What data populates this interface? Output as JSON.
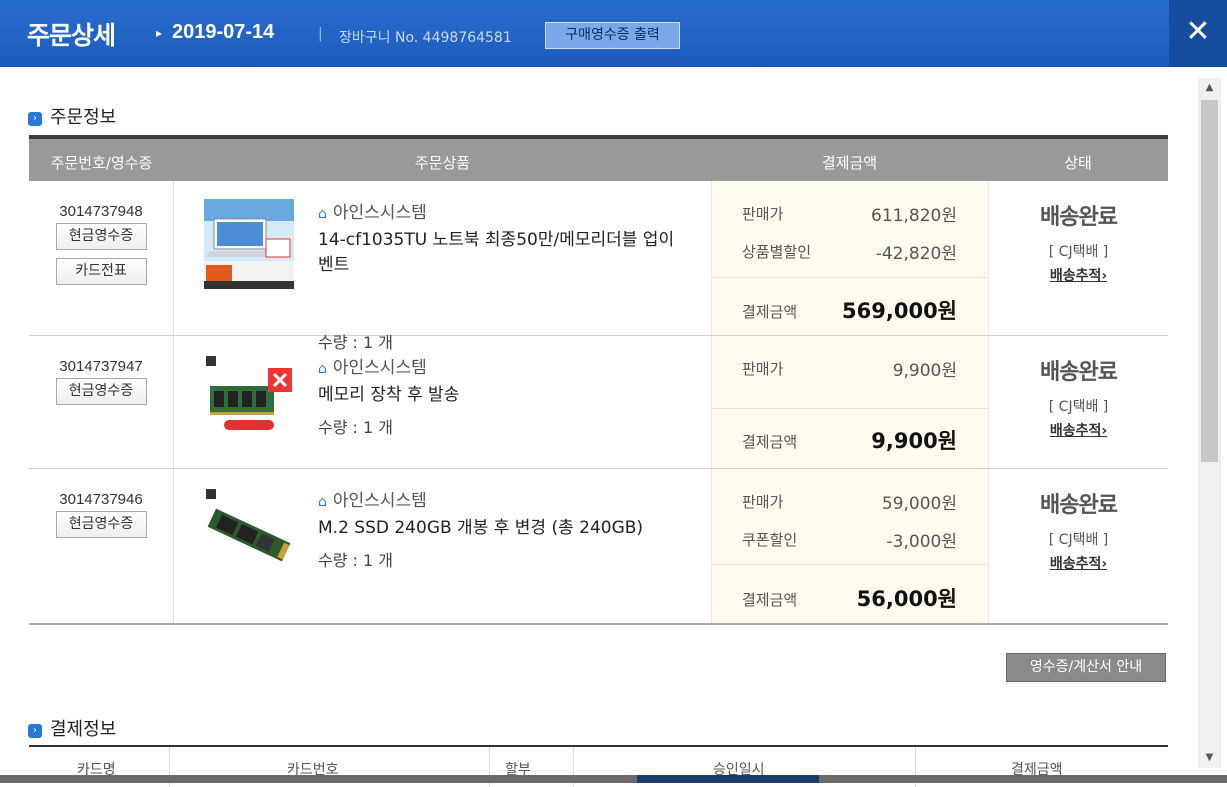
{
  "header": {
    "title": "주문상세",
    "date": "2019-07-14",
    "separator": "|",
    "cart_label": "장바구니 No. 4498764581",
    "receipt_print_label": "구매영수증 출력",
    "close_glyph": "✕"
  },
  "order_section": {
    "title": "주문정보",
    "columns": [
      "주문번호/영수증",
      "주문상품",
      "결제금액",
      "상태"
    ],
    "rows": [
      {
        "order_no": "3014737948",
        "buttons": [
          "현금영수증",
          "카드전표"
        ],
        "seller": "아인스시스템",
        "product": "14-cf1035TU 노트북 최종50만/메모리더블 업이벤트",
        "qty": "수량 : 1 개",
        "price_label": "판매가",
        "price": "611,820원",
        "discount_label": "상품별할인",
        "discount": "-42,820원",
        "total_label": "결제금액",
        "total": "569,000원",
        "status": "배송완료",
        "courier": "[ CJ택배 ]",
        "track_label": "배송추적"
      },
      {
        "order_no": "3014737947",
        "buttons": [
          "현금영수증"
        ],
        "seller": "아인스시스템",
        "product": "메모리 장착 후 발송",
        "qty": "수량 : 1 개",
        "price_label": "판매가",
        "price": "9,900원",
        "total_label": "결제금액",
        "total": "9,900원",
        "status": "배송완료",
        "courier": "[ CJ택배 ]",
        "track_label": "배송추적"
      },
      {
        "order_no": "3014737946",
        "buttons": [
          "현금영수증"
        ],
        "seller": "아인스시스템",
        "product": "M.2 SSD 240GB 개봉 후 변경 (총 240GB)",
        "qty": "수량 : 1 개",
        "price_label": "판매가",
        "price": "59,000원",
        "discount_label": "쿠폰할인",
        "discount": "-3,000원",
        "total_label": "결제금액",
        "total": "56,000원",
        "status": "배송완료",
        "courier": "[ CJ택배 ]",
        "track_label": "배송추적"
      }
    ],
    "receipt_guide_label": "영수증/계산서 안내"
  },
  "payment_section": {
    "title": "결제정보",
    "columns": [
      "카드명",
      "카드번호",
      "할부",
      "승인일시",
      "결제금액"
    ]
  },
  "colors": {
    "header": "#1c5bbb",
    "accent": "#2878d6",
    "table_head": "#999999",
    "pay_bg": "#fffcef"
  }
}
